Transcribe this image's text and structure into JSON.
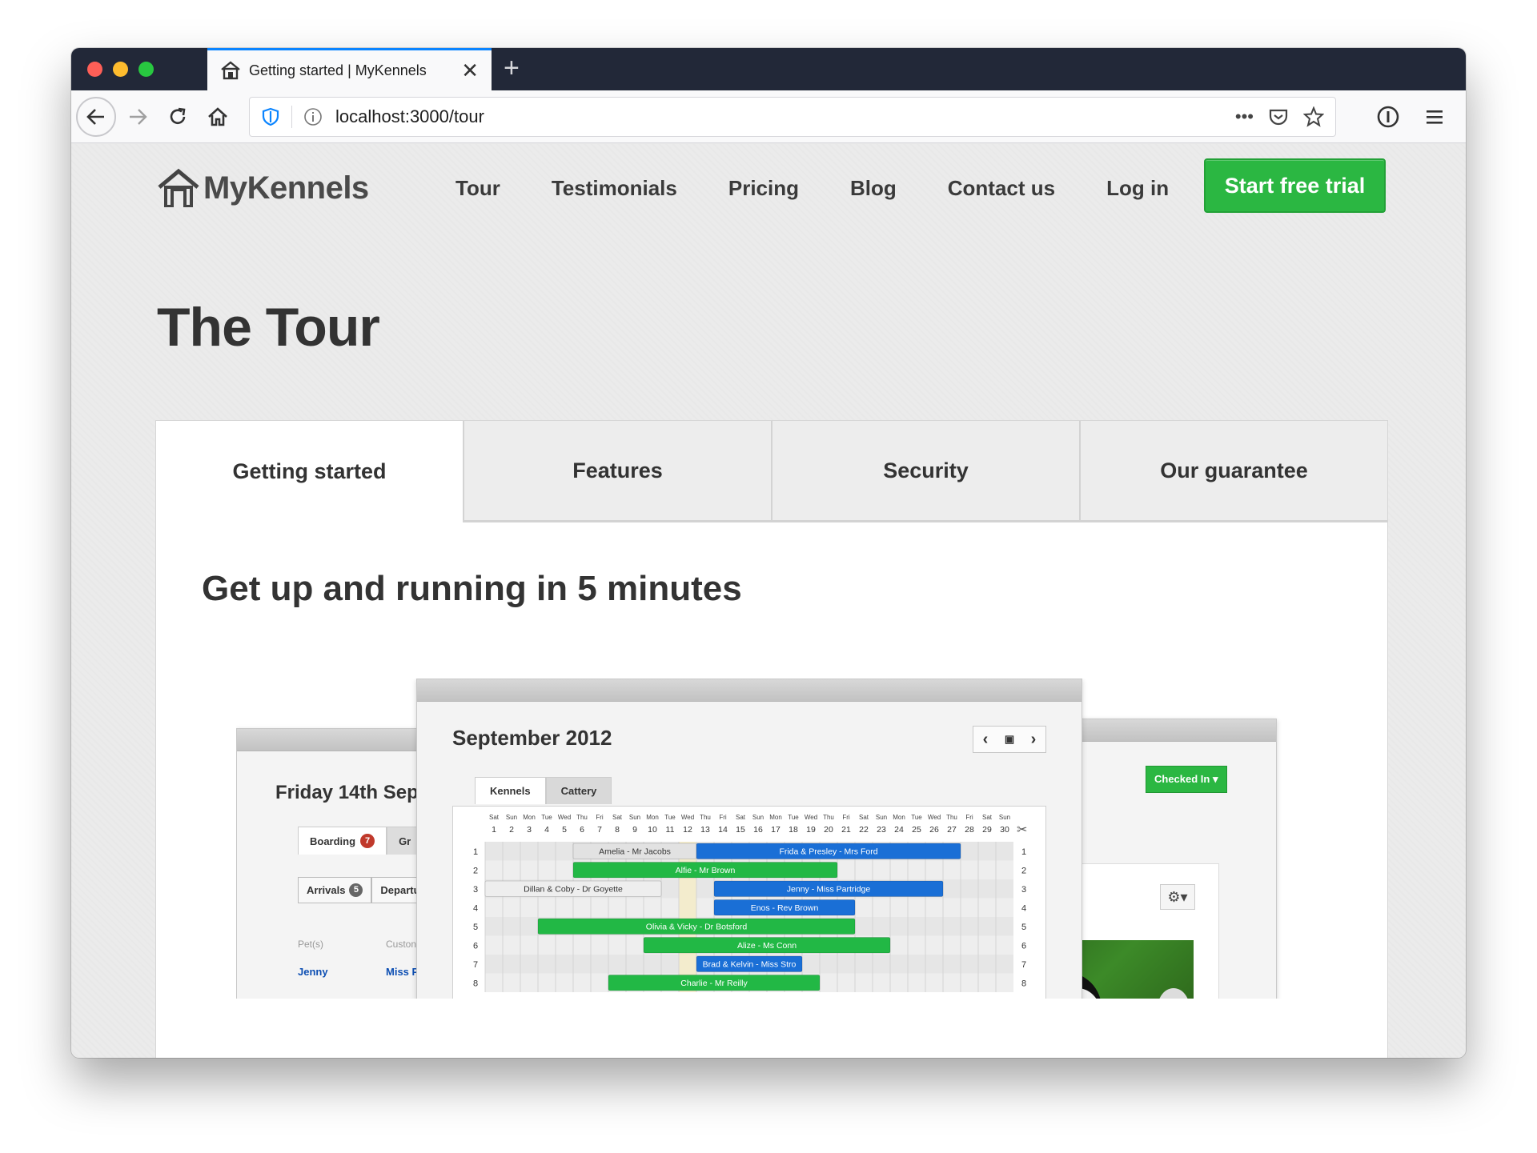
{
  "browser": {
    "tab_title": "Getting started | MyKennels",
    "url": "localhost:3000/tour"
  },
  "site": {
    "logo_text": "MyKennels",
    "nav": [
      "Tour",
      "Testimonials",
      "Pricing",
      "Blog",
      "Contact us",
      "Log in"
    ],
    "cta": "Start free trial",
    "page_title": "The Tour"
  },
  "tour": {
    "tabs": [
      "Getting started",
      "Features",
      "Security",
      "Our guarantee"
    ],
    "active_tab": "Getting started",
    "heading": "Get up and running in 5 minutes"
  },
  "illustration": {
    "left": {
      "date": "Friday 14th Sep",
      "tab_boarding": "Boarding",
      "boarding_count": "7",
      "tab_other": "Gr",
      "btn_arrivals": "Arrivals",
      "arrivals_count": "5",
      "btn_departures": "Departu",
      "col_pets": "Pet(s)",
      "col_customer": "Custon",
      "row_pet": "Jenny",
      "row_customer": "Miss P"
    },
    "main": {
      "month": "September 2012",
      "tab_kennels": "Kennels",
      "tab_cattery": "Cattery",
      "weekdays": [
        "Sat",
        "Sun",
        "Mon",
        "Tue",
        "Wed",
        "Thu",
        "Fri",
        "Sat",
        "Sun",
        "Mon",
        "Tue",
        "Wed",
        "Thu",
        "Fri",
        "Sat",
        "Sun",
        "Mon",
        "Tue",
        "Wed",
        "Thu",
        "Fri",
        "Sat",
        "Sun",
        "Mon",
        "Tue",
        "Wed",
        "Thu",
        "Fri",
        "Sat",
        "Sun"
      ],
      "days": [
        1,
        2,
        3,
        4,
        5,
        6,
        7,
        8,
        9,
        10,
        11,
        12,
        13,
        14,
        15,
        16,
        17,
        18,
        19,
        20,
        21,
        22,
        23,
        24,
        25,
        26,
        27,
        28,
        29,
        30
      ],
      "rows": [
        1,
        2,
        3,
        4,
        5,
        6,
        7,
        8
      ],
      "bookings": [
        {
          "label": "Amelia - Mr Jacobs",
          "row": 1,
          "start": 6,
          "end": 12,
          "color": "#e2e2e2",
          "text": "#333333"
        },
        {
          "label": "Frida & Presley - Mrs Ford",
          "row": 1,
          "start": 13,
          "end": 27,
          "color": "#1a6fd6",
          "text": "#ffffff"
        },
        {
          "label": "Alfie - Mr Brown",
          "row": 2,
          "start": 6,
          "end": 20,
          "color": "#22b845",
          "text": "#ffffff"
        },
        {
          "label": "Dillan & Coby - Dr Goyette",
          "row": 3,
          "start": 1,
          "end": 10,
          "color": "#eeeeee",
          "text": "#333333"
        },
        {
          "label": "Jenny - Miss Partridge",
          "row": 3,
          "start": 14,
          "end": 26,
          "color": "#1a6fd6",
          "text": "#ffffff"
        },
        {
          "label": "Enos - Rev Brown",
          "row": 4,
          "start": 14,
          "end": 21,
          "color": "#1a6fd6",
          "text": "#ffffff"
        },
        {
          "label": "Olivia & Vicky - Dr Botsford",
          "row": 5,
          "start": 4,
          "end": 21,
          "color": "#22b845",
          "text": "#ffffff"
        },
        {
          "label": "Alize - Ms Conn",
          "row": 6,
          "start": 10,
          "end": 23,
          "color": "#22b845",
          "text": "#ffffff"
        },
        {
          "label": "Brad & Kelvin - Miss Stro",
          "row": 7,
          "start": 13,
          "end": 18,
          "color": "#1a6fd6",
          "text": "#ffffff"
        },
        {
          "label": "Charlie - Mr Reilly",
          "row": 8,
          "start": 8,
          "end": 19,
          "color": "#22b845",
          "text": "#ffffff"
        }
      ]
    },
    "right": {
      "status_button": "Checked In"
    }
  },
  "colors": {
    "cta_green": "#2bb742",
    "tab_accent": "#0a84ff",
    "titlebar": "#222838"
  }
}
